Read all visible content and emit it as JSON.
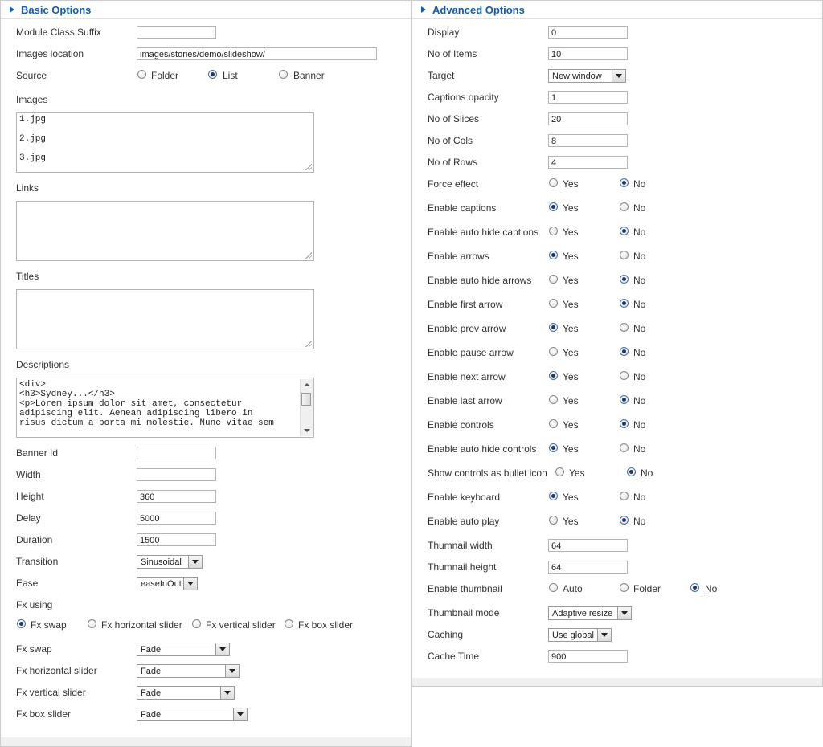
{
  "basic": {
    "title": "Basic Options",
    "module_class_suffix": {
      "label": "Module Class Suffix",
      "value": ""
    },
    "images_location": {
      "label": "Images location",
      "value": "images/stories/demo/slideshow/"
    },
    "source": {
      "label": "Source",
      "options": [
        "Folder",
        "List",
        "Banner"
      ],
      "selected": "List"
    },
    "images": {
      "label": "Images",
      "value": "1.jpg\n\n2.jpg\n\n3.jpg"
    },
    "links": {
      "label": "Links",
      "value": ""
    },
    "titles": {
      "label": "Titles",
      "value": ""
    },
    "descriptions": {
      "label": "Descriptions",
      "value": "<div>\n<h3>Sydney...</h3>\n<p>Lorem ipsum dolor sit amet, consectetur\nadipiscing elit. Aenean adipiscing libero in\nrisus dictum a porta mi molestie. Nunc vitae sem"
    },
    "banner_id": {
      "label": "Banner Id",
      "value": ""
    },
    "width": {
      "label": "Width",
      "value": ""
    },
    "height": {
      "label": "Height",
      "value": "360"
    },
    "delay": {
      "label": "Delay",
      "value": "5000"
    },
    "duration": {
      "label": "Duration",
      "value": "1500"
    },
    "transition": {
      "label": "Transition",
      "value": "Sinusoidal"
    },
    "ease": {
      "label": "Ease",
      "value": "easeInOut"
    },
    "fx_using": {
      "label": "Fx using",
      "options": [
        "Fx swap",
        "Fx horizontal slider",
        "Fx vertical slider",
        "Fx box slider"
      ],
      "selected": "Fx swap"
    },
    "fx_swap": {
      "label": "Fx swap",
      "value": "Fade"
    },
    "fx_horizontal_slider": {
      "label": "Fx horizontal slider",
      "value": "Fade"
    },
    "fx_vertical_slider": {
      "label": "Fx vertical slider",
      "value": "Fade"
    },
    "fx_box_slider": {
      "label": "Fx box slider",
      "value": "Fade"
    }
  },
  "advanced": {
    "title": "Advanced Options",
    "display": {
      "label": "Display",
      "value": "0"
    },
    "no_of_items": {
      "label": "No of Items",
      "value": "10"
    },
    "target": {
      "label": "Target",
      "value": "New window"
    },
    "captions_opacity": {
      "label": "Captions opacity",
      "value": "1"
    },
    "no_of_slices": {
      "label": "No of Slices",
      "value": "20"
    },
    "no_of_cols": {
      "label": "No of Cols",
      "value": "8"
    },
    "no_of_rows": {
      "label": "No of Rows",
      "value": "4"
    },
    "yes_label": "Yes",
    "no_label": "No",
    "toggles": [
      {
        "label": "Force effect",
        "selected": "No"
      },
      {
        "label": "Enable captions",
        "selected": "Yes"
      },
      {
        "label": "Enable auto hide captions",
        "selected": "No"
      },
      {
        "label": "Enable arrows",
        "selected": "Yes"
      },
      {
        "label": "Enable auto hide arrows",
        "selected": "No"
      },
      {
        "label": "Enable first arrow",
        "selected": "No"
      },
      {
        "label": "Enable prev arrow",
        "selected": "Yes"
      },
      {
        "label": "Enable pause arrow",
        "selected": "No"
      },
      {
        "label": "Enable next arrow",
        "selected": "Yes"
      },
      {
        "label": "Enable last arrow",
        "selected": "No"
      },
      {
        "label": "Enable controls",
        "selected": "No"
      },
      {
        "label": "Enable auto hide controls",
        "selected": "Yes"
      },
      {
        "label": "Show controls as bullet icon",
        "selected": "No"
      },
      {
        "label": "Enable keyboard",
        "selected": "Yes"
      },
      {
        "label": "Enable auto play",
        "selected": "No"
      }
    ],
    "thumbnail_width": {
      "label": "Thumnail width",
      "value": "64"
    },
    "thumbnail_height": {
      "label": "Thumnail height",
      "value": "64"
    },
    "enable_thumbnail": {
      "label": "Enable thumbnail",
      "options": [
        "Auto",
        "Folder",
        "No"
      ],
      "selected": "No"
    },
    "thumbnail_mode": {
      "label": "Thumbnail mode",
      "value": "Adaptive resize"
    },
    "caching": {
      "label": "Caching",
      "value": "Use global"
    },
    "cache_time": {
      "label": "Cache Time",
      "value": "900"
    }
  }
}
